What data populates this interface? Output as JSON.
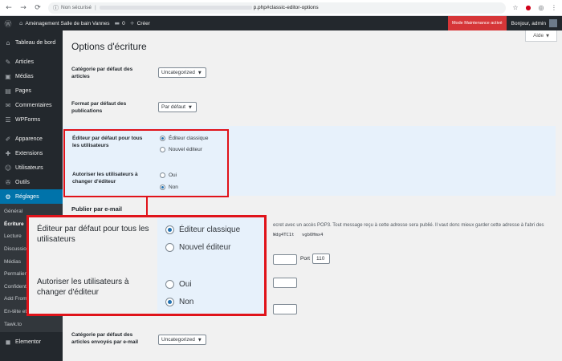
{
  "browser": {
    "back": "←",
    "forward": "→",
    "reload": "⟳",
    "info_icon": "ⓘ",
    "security_label": "Non sécurisé",
    "separator": "|",
    "url_path": "p.php#classic-editor-options",
    "icons": [
      "star-icon",
      "opera-icon",
      "vpn-icon",
      "menu-icon"
    ]
  },
  "adminbar": {
    "site_name": "Aménagement Salle de bain Vannes",
    "comments_count": "0",
    "new_label": "Créer",
    "maintenance_label": "Mode Maintenance activé",
    "howdy": "Bonjour, admin"
  },
  "sidebar": {
    "items": [
      {
        "label": "Tableau de bord",
        "icon": "⌂"
      },
      {
        "label": "Articles",
        "icon": "✎"
      },
      {
        "label": "Médias",
        "icon": "▣"
      },
      {
        "label": "Pages",
        "icon": "▤"
      },
      {
        "label": "Commentaires",
        "icon": "✉"
      },
      {
        "label": "WPForms",
        "icon": "☰"
      },
      {
        "label": "Apparence",
        "icon": "✐"
      },
      {
        "label": "Extensions",
        "icon": "✚"
      },
      {
        "label": "Utilisateurs",
        "icon": "☺"
      },
      {
        "label": "Outils",
        "icon": "✇"
      },
      {
        "label": "Réglages",
        "icon": "⚙"
      }
    ],
    "submenu": [
      "Général",
      "Écriture",
      "Lecture",
      "Discussion",
      "Médias",
      "Permaliens",
      "Confidentialité",
      "Add From…",
      "En-tête et pied…",
      "Tawk.to"
    ],
    "elementor": {
      "label": "Elementor",
      "icon": "◼"
    }
  },
  "main": {
    "help_label": "Aide",
    "page_title": "Options d'écriture",
    "default_category_label": "Catégorie par défaut des articles",
    "default_category_value": "Uncategorized",
    "default_format_label": "Format par défaut des publications",
    "default_format_value": "Par défaut",
    "default_editor_label": "Éditeur par défaut pour tous les utilisateurs",
    "editor_options": [
      {
        "label": "Éditeur classique",
        "checked": true
      },
      {
        "label": "Nouvel éditeur",
        "checked": false
      }
    ],
    "allow_switch_label": "Autoriser les utilisateurs à changer d'éditeur",
    "switch_options": [
      {
        "label": "Oui",
        "checked": false
      },
      {
        "label": "Non",
        "checked": true
      }
    ],
    "post_by_email_title": "Publier par e-mail",
    "post_by_email_desc": "ecret avec un accès POP3. Tout message reçu à cette adresse sera publié. Il vaut donc mieux garder cette adresse à l'abri des",
    "code1": "Wdg4TC1t",
    "code2": "vgbOHmx4",
    "port_label": "Port",
    "port_value": "110",
    "email_category_label": "Catégorie par défaut des articles envoyés par e-mail",
    "email_category_value": "Uncategorized"
  },
  "zoom": {
    "default_editor_label": "Éditeur par défaut pour tous les utilisateurs",
    "editor_options": [
      {
        "label": "Éditeur classique",
        "checked": true
      },
      {
        "label": "Nouvel éditeur",
        "checked": false
      }
    ],
    "allow_switch_label": "Autoriser les utilisateurs à changer d'éditeur",
    "switch_options": [
      {
        "label": "Oui",
        "checked": false
      },
      {
        "label": "Non",
        "checked": true
      }
    ]
  },
  "colors": {
    "admin_dark": "#23282d",
    "admin_blue": "#0073aa",
    "highlight_band": "#e7f1fb",
    "annotation_red": "#e0131a",
    "maintenance_red": "#d63638"
  }
}
